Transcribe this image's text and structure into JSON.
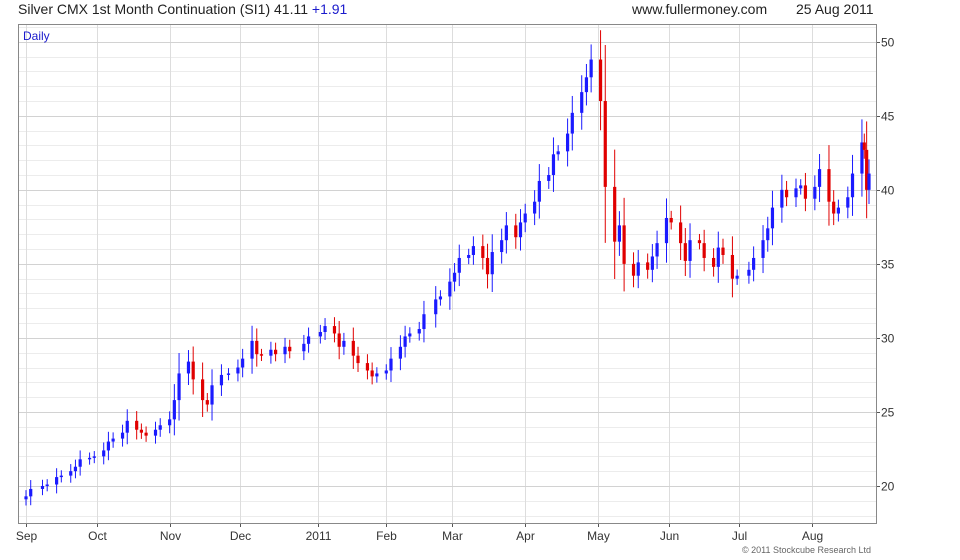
{
  "header": {
    "instrument": "Silver CMX 1st Month Continuation (SI1)",
    "last": "41.11",
    "change": "+1.91",
    "site": "www.fullermoney.com",
    "date": "25 Aug 2011"
  },
  "copyright": "© 2011 Stockcube Research Ltd",
  "chart_data": {
    "type": "candlestick",
    "period_label": "Daily",
    "x_tick_labels": [
      "Sep",
      "Oct",
      "Nov",
      "Dec",
      "2011",
      "Feb",
      "Mar",
      "Apr",
      "May",
      "Jun",
      "Jul",
      "Aug"
    ],
    "y_tick_labels": [
      "20",
      "25",
      "30",
      "35",
      "40",
      "45",
      "50"
    ],
    "ylim": [
      17.5,
      51.2
    ],
    "grid": true,
    "colors": {
      "up": "#1a1aff",
      "down": "#e00000",
      "grid": "#dddddd"
    },
    "series": {
      "x": [
        "2010-09-01",
        "2010-09-03",
        "2010-09-08",
        "2010-09-10",
        "2010-09-14",
        "2010-09-16",
        "2010-09-20",
        "2010-09-22",
        "2010-09-24",
        "2010-09-28",
        "2010-09-30",
        "2010-10-04",
        "2010-10-06",
        "2010-10-08",
        "2010-10-12",
        "2010-10-14",
        "2010-10-18",
        "2010-10-20",
        "2010-10-22",
        "2010-10-26",
        "2010-10-28",
        "2010-11-01",
        "2010-11-03",
        "2010-11-05",
        "2010-11-09",
        "2010-11-11",
        "2010-11-15",
        "2010-11-17",
        "2010-11-19",
        "2010-11-23",
        "2010-11-26",
        "2010-11-30",
        "2010-12-02",
        "2010-12-06",
        "2010-12-08",
        "2010-12-10",
        "2010-12-14",
        "2010-12-16",
        "2010-12-20",
        "2010-12-22",
        "2010-12-28",
        "2010-12-30",
        "2011-01-04",
        "2011-01-06",
        "2011-01-10",
        "2011-01-12",
        "2011-01-14",
        "2011-01-18",
        "2011-01-20",
        "2011-01-24",
        "2011-01-26",
        "2011-01-28",
        "2011-02-01",
        "2011-02-03",
        "2011-02-07",
        "2011-02-09",
        "2011-02-11",
        "2011-02-15",
        "2011-02-17",
        "2011-02-22",
        "2011-02-24",
        "2011-02-28",
        "2011-03-02",
        "2011-03-04",
        "2011-03-08",
        "2011-03-10",
        "2011-03-14",
        "2011-03-16",
        "2011-03-18",
        "2011-03-22",
        "2011-03-24",
        "2011-03-28",
        "2011-03-30",
        "2011-04-01",
        "2011-04-05",
        "2011-04-07",
        "2011-04-11",
        "2011-04-13",
        "2011-04-15",
        "2011-04-19",
        "2011-04-21",
        "2011-04-25",
        "2011-04-27",
        "2011-04-29",
        "2011-05-03",
        "2011-05-05",
        "2011-05-09",
        "2011-05-11",
        "2011-05-13",
        "2011-05-17",
        "2011-05-19",
        "2011-05-23",
        "2011-05-25",
        "2011-05-27",
        "2011-05-31",
        "2011-06-02",
        "2011-06-06",
        "2011-06-08",
        "2011-06-10",
        "2011-06-14",
        "2011-06-16",
        "2011-06-20",
        "2011-06-22",
        "2011-06-24",
        "2011-06-28",
        "2011-06-30",
        "2011-07-05",
        "2011-07-07",
        "2011-07-11",
        "2011-07-13",
        "2011-07-15",
        "2011-07-19",
        "2011-07-21",
        "2011-07-25",
        "2011-07-27",
        "2011-07-29",
        "2011-08-02",
        "2011-08-04",
        "2011-08-08",
        "2011-08-10",
        "2011-08-12",
        "2011-08-16",
        "2011-08-18",
        "2011-08-22",
        "2011-08-23",
        "2011-08-24",
        "2011-08-25"
      ],
      "close": [
        19.3,
        19.8,
        20.0,
        20.1,
        20.6,
        20.7,
        21.0,
        21.3,
        21.8,
        21.9,
        22.0,
        22.4,
        23.0,
        23.2,
        23.6,
        24.4,
        23.8,
        23.6,
        23.4,
        23.8,
        24.1,
        24.5,
        25.8,
        27.6,
        28.4,
        27.2,
        25.8,
        25.5,
        26.8,
        27.5,
        27.6,
        28.0,
        28.6,
        29.8,
        28.9,
        28.8,
        29.2,
        28.9,
        29.4,
        29.1,
        29.6,
        30.1,
        30.4,
        30.8,
        30.3,
        29.4,
        29.8,
        28.8,
        28.3,
        27.8,
        27.4,
        27.6,
        27.8,
        28.6,
        29.4,
        30.1,
        30.3,
        30.6,
        31.6,
        32.6,
        32.8,
        33.8,
        34.4,
        35.4,
        35.6,
        36.2,
        35.4,
        34.3,
        35.8,
        36.6,
        37.6,
        36.8,
        37.8,
        38.4,
        39.2,
        40.6,
        41.0,
        42.4,
        42.6,
        43.8,
        45.2,
        46.6,
        47.6,
        48.8,
        46.0,
        40.2,
        36.5,
        37.6,
        35.0,
        34.2,
        35.1,
        34.6,
        35.5,
        36.4,
        38.1,
        37.8,
        36.4,
        35.2,
        36.6,
        36.4,
        35.4,
        34.8,
        36.1,
        35.6,
        34.0,
        34.2,
        34.6,
        35.4,
        36.6,
        37.4,
        38.8,
        40.0,
        39.5,
        40.1,
        40.3,
        39.4,
        40.2,
        41.4,
        39.2,
        38.4,
        38.8,
        39.5,
        41.1,
        43.2,
        42.7,
        40.0,
        41.1
      ]
    }
  }
}
